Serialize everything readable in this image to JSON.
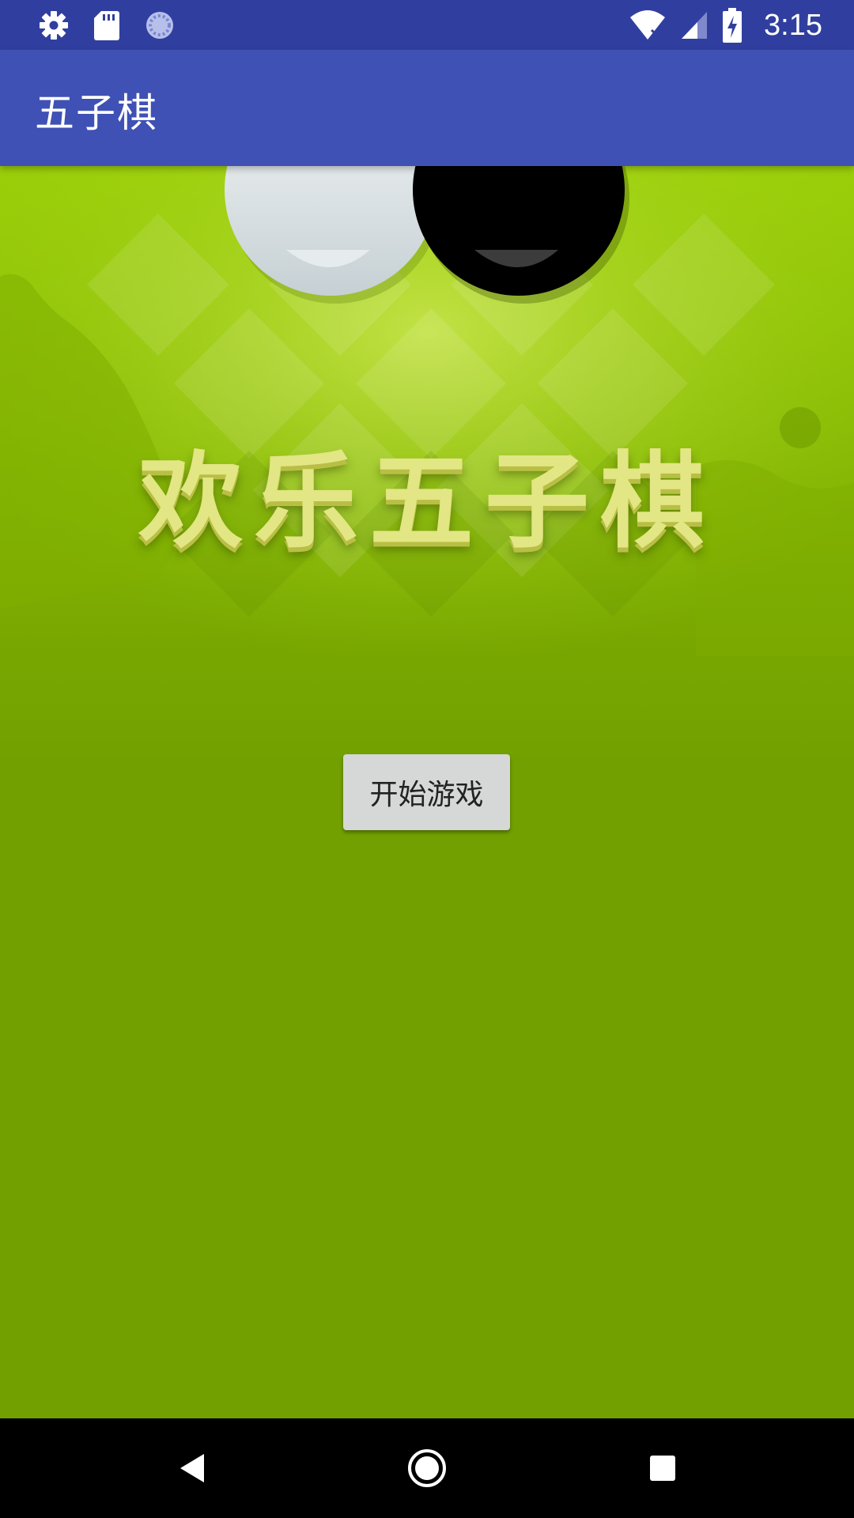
{
  "status_bar": {
    "time": "3:15",
    "icons_left": [
      "settings-icon",
      "sd-card-icon",
      "sync-icon"
    ],
    "icons_right": [
      "wifi-icon",
      "cell-signal-icon",
      "battery-charging-icon"
    ]
  },
  "app_bar": {
    "title": "五子棋"
  },
  "banner": {
    "title": "欢乐五子棋"
  },
  "main": {
    "start_button_label": "开始游戏"
  },
  "nav_bar": {
    "icons": [
      "back-icon",
      "home-icon",
      "recents-icon"
    ]
  },
  "colors": {
    "status_bar": "#303f9f",
    "app_bar": "#3f51b5",
    "background": "#72a000",
    "button": "#d6d7d7"
  }
}
